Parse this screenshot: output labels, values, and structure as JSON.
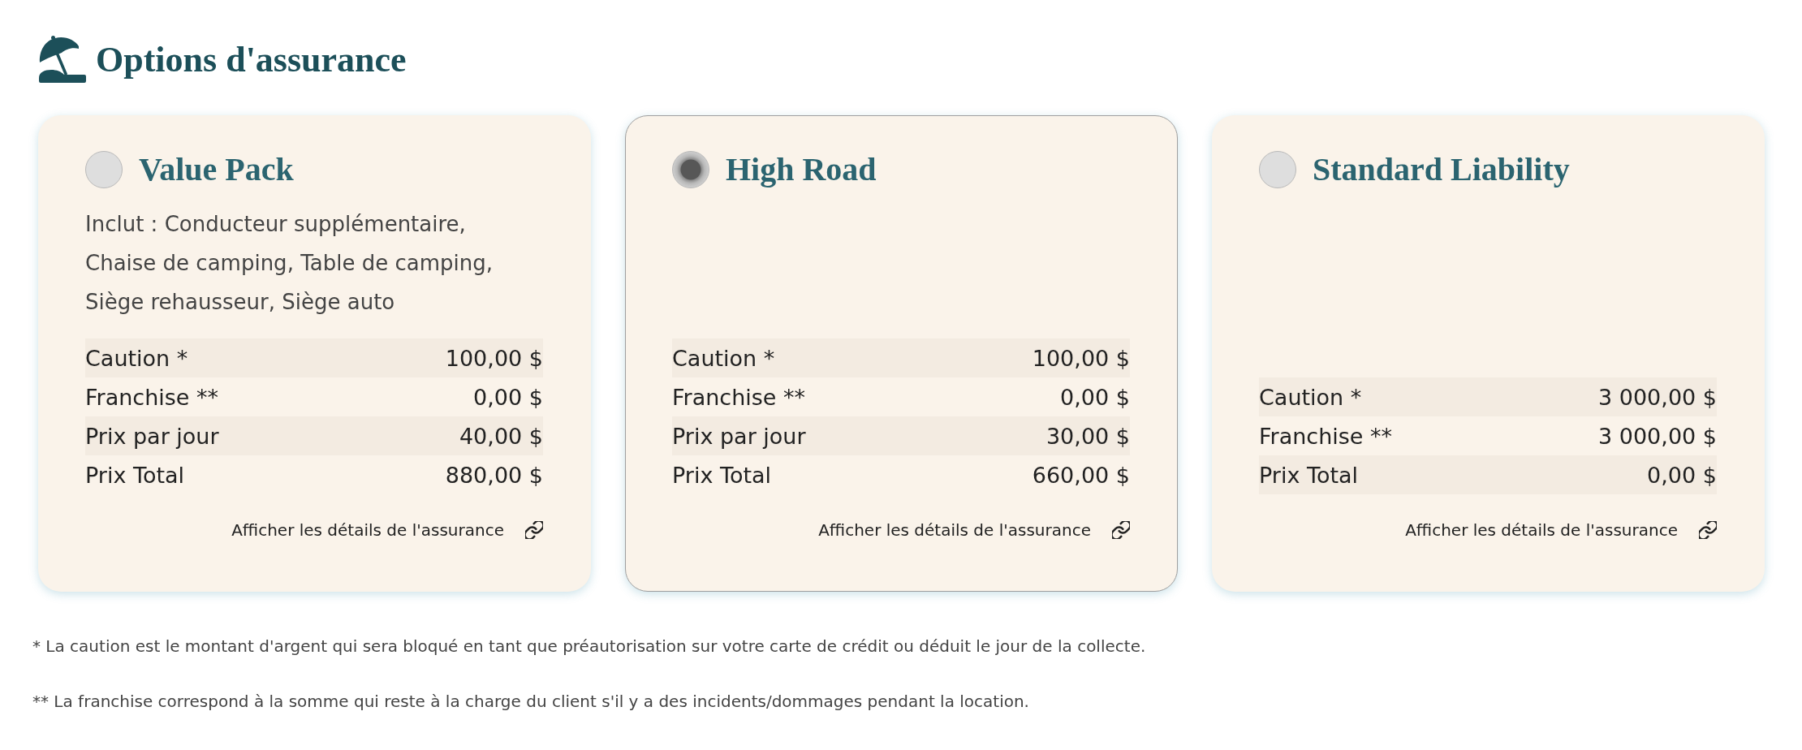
{
  "page": {
    "title": "Options d'assurance"
  },
  "options": [
    {
      "name": "Value Pack",
      "selected": false,
      "description": "Inclut : Conducteur supplémentaire, Chaise de camping, Table de camping, Siège rehausseur, Siège auto",
      "rows": [
        {
          "label": "Caution *",
          "value": "100,00 $"
        },
        {
          "label": "Franchise **",
          "value": "0,00 $"
        },
        {
          "label": "Prix par jour",
          "value": "40,00 $"
        },
        {
          "label": "Prix Total",
          "value": "880,00 $"
        }
      ],
      "link": "Afficher les détails de l'assurance"
    },
    {
      "name": "High Road",
      "selected": true,
      "rows": [
        {
          "label": "Caution *",
          "value": "100,00 $"
        },
        {
          "label": "Franchise **",
          "value": "0,00 $"
        },
        {
          "label": "Prix par jour",
          "value": "30,00 $"
        },
        {
          "label": "Prix Total",
          "value": "660,00 $"
        }
      ],
      "link": "Afficher les détails de l'assurance"
    },
    {
      "name": "Standard Liability",
      "selected": false,
      "rows": [
        {
          "label": "Caution *",
          "value": "3 000,00 $"
        },
        {
          "label": "Franchise **",
          "value": "3 000,00 $"
        },
        {
          "label": "Prix Total",
          "value": "0,00 $"
        }
      ],
      "link": "Afficher les détails de l'assurance"
    }
  ],
  "footnotes": [
    "* La caution est le montant d'argent qui sera bloqué en tant que préautorisation sur votre carte de crédit ou déduit le jour de la collecte.",
    "** La franchise correspond à la somme qui reste à la charge du client s'il y a des incidents/dommages pendant la location."
  ]
}
